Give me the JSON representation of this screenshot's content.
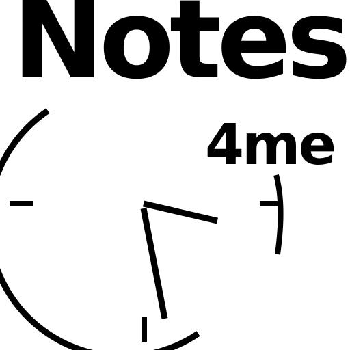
{
  "logo": {
    "title": "Notes",
    "subtitle": "4me",
    "icon": "clock-icon",
    "clock_hands": {
      "hour": "4:30",
      "minute": "29"
    },
    "colors": {
      "foreground": "#000000",
      "background": "#ffffff"
    }
  }
}
